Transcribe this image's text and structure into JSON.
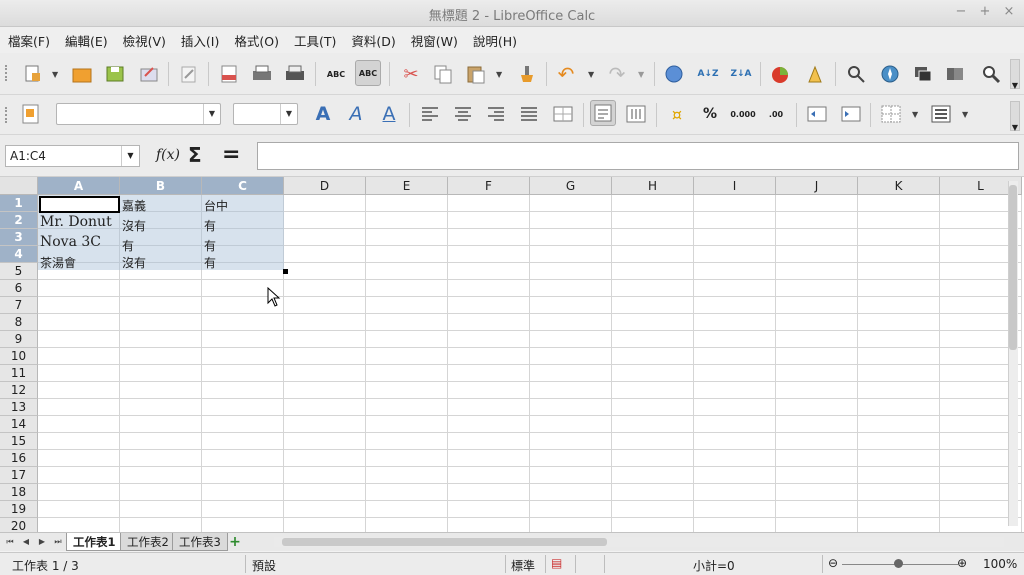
{
  "window": {
    "title": "無標題 2 - LibreOffice Calc",
    "min": "−",
    "max": "+",
    "close": "×"
  },
  "menu": [
    "檔案(F)",
    "編輯(E)",
    "檢視(V)",
    "插入(I)",
    "格式(O)",
    "工具(T)",
    "資料(D)",
    "視窗(W)",
    "說明(H)"
  ],
  "toolbar_standard": {
    "icons": [
      "new-document",
      "open-folder",
      "save",
      "export",
      "edit-file",
      "export-pdf",
      "print",
      "print-preview",
      "spellcheck",
      "autospellcheck",
      "cut",
      "copy",
      "paste",
      "clone-formatting",
      "undo",
      "redo",
      "hyperlink",
      "sort-ascending",
      "sort-descending",
      "insert-chart",
      "draw-functions",
      "navigator",
      "gallery",
      "data-sources",
      "zoom"
    ]
  },
  "toolbar_format": {
    "font_name": "",
    "font_size": "",
    "bold": "A",
    "italic": "A",
    "underline": "A",
    "percent": "%",
    "decimal": "0.000"
  },
  "formula_bar": {
    "name_box": "A1:C4",
    "fx": "f(x)",
    "sum": "Σ",
    "equals": "=",
    "content": ""
  },
  "sheet": {
    "columns": [
      "A",
      "B",
      "C",
      "D",
      "E",
      "F",
      "G",
      "H",
      "I",
      "J",
      "K",
      "L"
    ],
    "selected_columns": [
      "A",
      "B",
      "C"
    ],
    "rows": [
      "1",
      "2",
      "3",
      "4",
      "5",
      "6",
      "7",
      "8",
      "9",
      "10",
      "11",
      "12",
      "13",
      "14",
      "15",
      "16",
      "17",
      "18",
      "19",
      "20"
    ],
    "selected_rows": [
      "1",
      "2",
      "3",
      "4"
    ],
    "cells": {
      "B1": "嘉義",
      "C1": "台中",
      "A2": "Mr. Donut",
      "B2": "沒有",
      "C2": "有",
      "A3": "Nova 3C",
      "B3": "有",
      "C3": "有",
      "A4": "茶湯會",
      "B4": "沒有",
      "C4": "有"
    }
  },
  "tabs": {
    "sheets": [
      "工作表1",
      "工作表2",
      "工作表3"
    ],
    "active": "工作表1",
    "add": "+"
  },
  "status": {
    "sheet_pos": "工作表 1 / 3",
    "page_style": "預設",
    "mode": "標準",
    "sum": "小計=0",
    "zoom": "100%"
  },
  "colors": {
    "selection": "#a7bed7",
    "header_selected": "#9fb2c8"
  }
}
